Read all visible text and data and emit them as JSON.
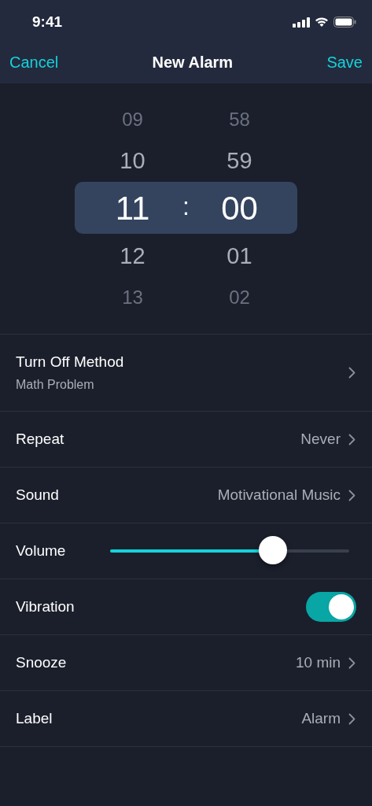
{
  "status_bar": {
    "time": "9:41"
  },
  "nav": {
    "cancel": "Cancel",
    "title": "New Alarm",
    "save": "Save"
  },
  "picker": {
    "separator": ":",
    "hours": [
      {
        "text": "09",
        "selected": false
      },
      {
        "text": "10",
        "selected": false
      },
      {
        "text": "11",
        "selected": true
      },
      {
        "text": "12",
        "selected": false
      },
      {
        "text": "13",
        "selected": false
      }
    ],
    "minutes": [
      {
        "text": "58",
        "selected": false
      },
      {
        "text": "59",
        "selected": false
      },
      {
        "text": "00",
        "selected": true
      },
      {
        "text": "01",
        "selected": false
      },
      {
        "text": "02",
        "selected": false
      }
    ]
  },
  "settings": [
    {
      "kind": "nav",
      "label": "Turn Off Method",
      "subtitle": "Math Problem"
    },
    {
      "kind": "nav",
      "label": "Repeat",
      "value": "Never"
    },
    {
      "kind": "nav",
      "label": "Sound",
      "value": "Motivational Music"
    },
    {
      "kind": "slider",
      "label": "Volume",
      "level": 0.68
    },
    {
      "kind": "toggle",
      "label": "Vibration",
      "on": true
    },
    {
      "kind": "nav",
      "label": "Snooze",
      "value": "10 min"
    },
    {
      "kind": "nav",
      "label": "Label",
      "value": "Alarm"
    }
  ]
}
